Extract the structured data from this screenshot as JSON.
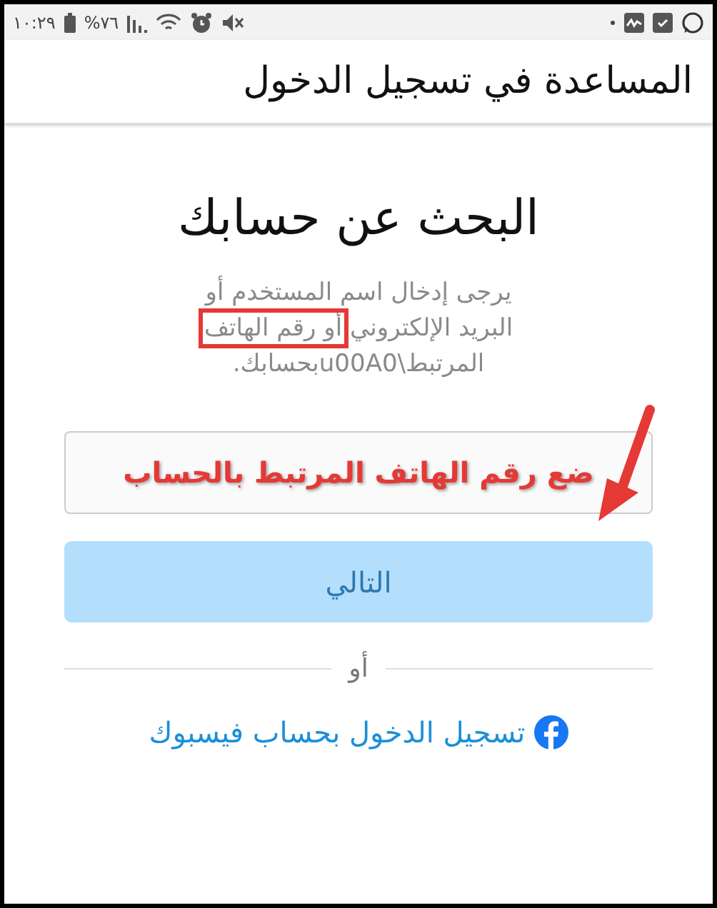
{
  "status_bar": {
    "time": "١٠:٢٩",
    "battery": "%٧٦"
  },
  "header": {
    "title": "المساعدة في تسجيل الدخول"
  },
  "heading": "البحث عن حسابك",
  "description": {
    "before": "يرجى إدخال اسم المستخدم أو البريد الإلكتروني ",
    "highlighted": "أو رقم الهاتف",
    "after": " المرتبط\\u00A0بحسابك."
  },
  "field": {
    "annotation": "ضع رقم الهاتف المرتبط بالحساب"
  },
  "next_button": {
    "label": "التالي",
    "disabled": true
  },
  "divider": "أو",
  "facebook_link": "تسجيل الدخول بحساب فيسبوك"
}
